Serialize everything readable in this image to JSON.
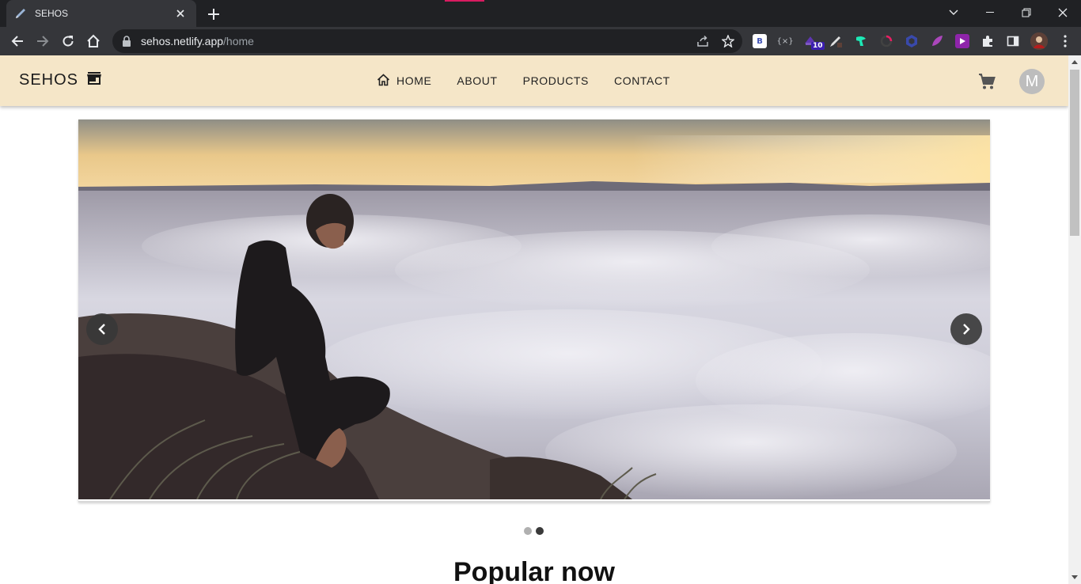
{
  "browser": {
    "tab_title": "SEHOS",
    "url_host": "sehos.netlify.app",
    "url_path": "/home",
    "extension_badge": "10"
  },
  "site": {
    "brand": "SEHOS",
    "nav": [
      {
        "label": "HOME",
        "icon": "home-icon"
      },
      {
        "label": "ABOUT"
      },
      {
        "label": "PRODUCTS"
      },
      {
        "label": "CONTACT"
      }
    ],
    "avatar_initial": "M",
    "carousel": {
      "slide_count": 2,
      "active_index": 1
    },
    "section_title": "Popular now"
  },
  "colors": {
    "appbar_bg": "#f5e6c8",
    "chrome_dark": "#202124",
    "chrome_toolbar": "#35363a",
    "dot_inactive": "#b0b0b0",
    "dot_active": "#3a3a3a"
  }
}
